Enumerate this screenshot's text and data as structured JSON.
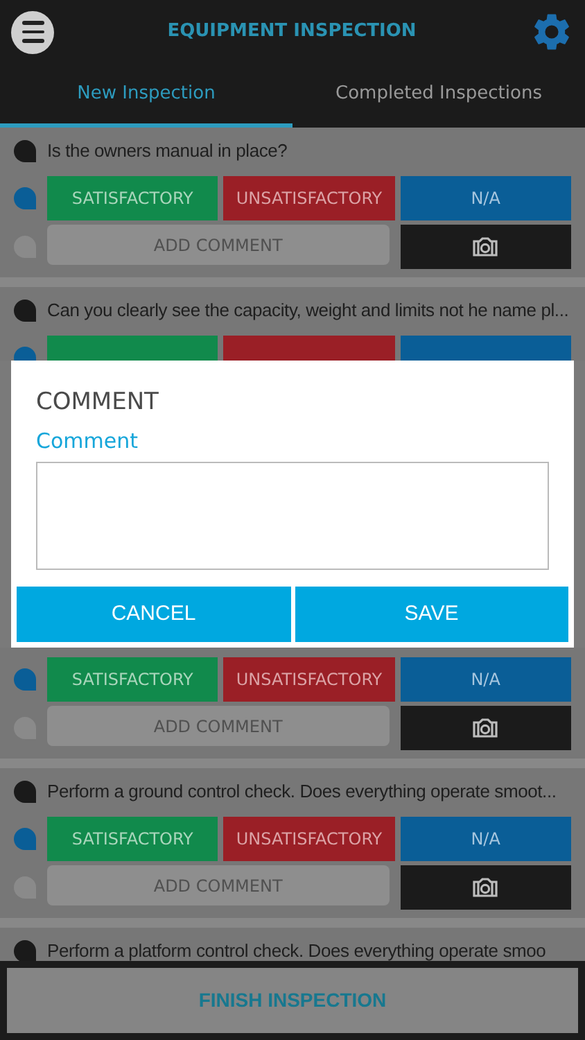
{
  "header": {
    "title": "EQUIPMENT INSPECTION"
  },
  "tabs": [
    {
      "label": "New Inspection",
      "selected": true
    },
    {
      "label": "Completed Inspections",
      "selected": false
    }
  ],
  "items_above_dialog": [
    {
      "question": "Is the owners manual in place?",
      "answers": [
        {
          "kind": "satisfactory",
          "label": "SATISFACTORY"
        },
        {
          "kind": "unsatisfactory",
          "label": "UNSATISFACTORY"
        },
        {
          "kind": "na",
          "label": "N/A"
        }
      ],
      "comment_placeholder": "ADD COMMENT"
    },
    {
      "question": "Can you clearly see the capacity, weight and limits not he name pl...",
      "answers": [
        {
          "kind": "satisfactory"
        },
        {
          "kind": "unsatisfactory"
        },
        {
          "kind": "na"
        }
      ]
    }
  ],
  "dialog": {
    "title": "COMMENT",
    "field_label": "Comment",
    "buttons": [
      "CANCEL",
      "SAVE"
    ]
  },
  "items_below_dialog": [
    {
      "answers": [
        {
          "kind": "satisfactory",
          "label": "SATISFACTORY"
        },
        {
          "kind": "unsatisfactory",
          "label": "UNSATISFACTORY"
        },
        {
          "kind": "na",
          "label": "N/A"
        }
      ],
      "comment_placeholder": "ADD COMMENT"
    },
    {
      "question": "Perform a ground control check. Does everything operate smoot...",
      "answers": [
        {
          "kind": "satisfactory",
          "label": "SATISFACTORY"
        },
        {
          "kind": "unsatisfactory",
          "label": "UNSATISFACTORY"
        },
        {
          "kind": "na",
          "label": "N/A"
        }
      ],
      "comment_placeholder": "ADD COMMENT"
    },
    {
      "question": "Perform a platform control check. Does everything operate smoo"
    }
  ],
  "footer_button": "FINISH INSPECTION"
}
